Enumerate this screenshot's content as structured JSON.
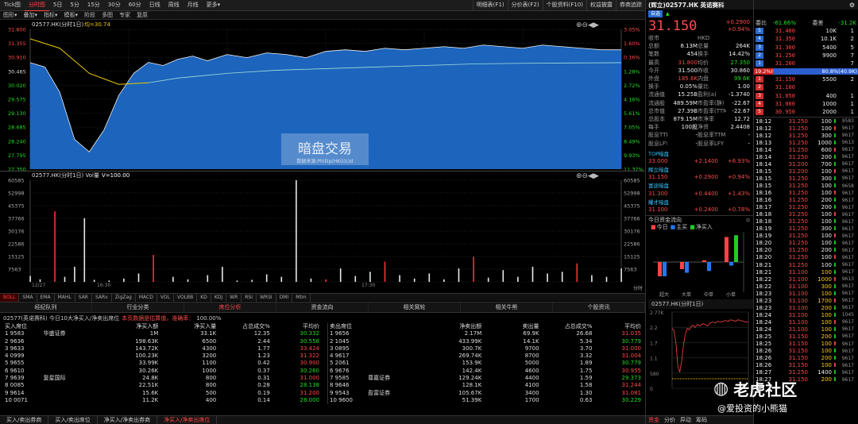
{
  "toolbar": {
    "tabs": [
      "Tick图",
      "分时图",
      "5日",
      "5分",
      "15分",
      "30分",
      "60分",
      "日线",
      "周线",
      "月线",
      "更多▾"
    ],
    "right_tabs": [
      "明细表(F1)",
      "分价表(F2)",
      "个股资料(F10)",
      "权益披露",
      "券商追踪"
    ]
  },
  "menu": [
    "图形▾",
    "叠加▾",
    "指标▾",
    "模板▾",
    "阶段",
    "多图",
    "专家",
    "复原"
  ],
  "main_chart": {
    "title": "02577.HK(分时1日)",
    "avg_label": "均=30.74",
    "watermark": "暗盘交易",
    "watermark_sub": "数据来源:Phillip(HKG)Ltd",
    "left_axis": [
      "31.800",
      "31.355",
      "30.910",
      "30.465",
      "30.020",
      "29.575",
      "29.130",
      "28.685",
      "28.240",
      "27.795",
      "27.350"
    ],
    "right_axis": [
      "3.05%",
      "1.60%",
      "0.16%",
      "1.28%",
      "2.72%",
      "4.16%",
      "5.61%",
      "7.05%",
      "8.49%",
      "9.93%",
      "11.37%"
    ],
    "line_color": "#e8c800",
    "avg_color": "#88c8c8",
    "fill_color": "#1f6fd0"
  },
  "vol_chart": {
    "title": "02577.HK(分时1日) Vol量",
    "vol_label": "V=100.00",
    "axis": [
      "60585",
      "52998",
      "45375",
      "37766",
      "30176",
      "22586",
      "15125",
      "7563"
    ],
    "dates": [
      "12/27",
      "16:30",
      "17:30"
    ],
    "tail": "分时"
  },
  "chart_data": [
    {
      "type": "line",
      "name": "price",
      "ylim": [
        27.35,
        31.8
      ],
      "x": [
        0,
        3,
        6,
        9,
        12,
        15,
        18,
        21,
        24,
        27,
        30,
        33,
        36,
        40,
        44,
        48,
        52,
        56,
        60,
        64,
        68,
        72,
        76,
        80,
        84,
        88,
        92,
        96,
        100,
        104,
        108,
        112,
        116,
        120
      ],
      "values": [
        30.74,
        30.6,
        29.8,
        28.3,
        27.9,
        28.6,
        29.7,
        30.4,
        30.75,
        30.65,
        30.85,
        30.95,
        30.8,
        31.0,
        30.9,
        31.05,
        31.0,
        30.9,
        31.1,
        31.15,
        31.1,
        31.2,
        31.15,
        31.2,
        31.25,
        31.2,
        31.3,
        31.25,
        31.2,
        31.3,
        31.25,
        31.2,
        31.15,
        31.15
      ]
    },
    {
      "type": "line",
      "name": "avg",
      "ylim": [
        27.35,
        31.8
      ],
      "x": [
        0,
        6,
        12,
        18,
        24,
        30,
        40,
        50,
        60,
        70,
        80,
        90,
        100,
        110,
        120
      ],
      "values": [
        31.5,
        31.2,
        30.4,
        30.05,
        30.1,
        30.25,
        30.4,
        30.5,
        30.55,
        30.6,
        30.65,
        30.7,
        30.72,
        30.73,
        30.74
      ]
    },
    {
      "type": "bar",
      "name": "volume",
      "ylim": [
        0,
        60585
      ],
      "x": [
        0,
        2,
        5,
        7,
        9,
        11,
        13,
        16,
        19,
        22,
        25,
        29,
        32,
        36,
        39,
        42,
        45,
        48,
        51,
        54,
        57,
        60,
        63,
        66,
        69,
        72,
        75,
        78,
        81,
        84,
        87,
        90,
        93,
        96,
        99,
        102,
        105,
        108,
        111,
        114,
        117,
        120
      ],
      "values": [
        3500,
        1500,
        42000,
        3000,
        9000,
        38000,
        1200,
        800,
        2000,
        5000,
        16000,
        3000,
        1500,
        4000,
        9000,
        800,
        1200,
        4500,
        3000,
        60585,
        2000,
        1500,
        8000,
        3500,
        6000,
        12000,
        4000,
        2000,
        5000,
        1500,
        8000,
        15000,
        2500,
        7000,
        3000,
        9000,
        5000,
        6000,
        11000,
        4000,
        3000,
        8000
      ],
      "colors": [
        "white",
        "white",
        "red",
        "white",
        "white",
        "white",
        "white",
        "white",
        "white",
        "white",
        "red",
        "white",
        "white",
        "white",
        "white",
        "white",
        "white",
        "white",
        "white",
        "white",
        "white",
        "red",
        "white",
        "white",
        "white",
        "red",
        "white",
        "white",
        "white",
        "white",
        "white",
        "red",
        "white",
        "white",
        "white",
        "white",
        "white",
        "white",
        "red",
        "white",
        "white",
        "white"
      ]
    },
    {
      "type": "bar",
      "name": "capital",
      "categories": [
        "超大",
        "大单",
        "中单",
        "小单"
      ],
      "series": [
        {
          "name": "今日",
          "color": "#ff4444",
          "values": [
            -40,
            -20,
            5,
            70
          ]
        },
        {
          "name": "主买",
          "color": "#2277ee",
          "values": [
            -40,
            -30,
            -25,
            -10
          ]
        },
        {
          "name": "净买入",
          "color": "#22cc22",
          "values": [
            0,
            0,
            0,
            75
          ]
        }
      ]
    }
  ],
  "indicators": [
    "BOLL",
    "SMA",
    "EMA",
    "MAHL",
    "SAR",
    "SARv",
    "ZigZag",
    "MACD",
    "VOL",
    "VOLBB",
    "KD",
    "KDJ",
    "WR",
    "RSI",
    "WRSI",
    "DMI",
    "Mtm"
  ],
  "panel_tabs": [
    "经纪队列",
    "行业分类",
    "席位分析",
    "资金流向",
    "相关窝轮",
    "相关牛熊",
    "个股资讯"
  ],
  "broker": {
    "summary": "02577(英诺赛科) 今日10大净买入/净卖出席位",
    "note": "本页数据是估算值，准确率：",
    "accuracy": "100.00%",
    "buy_head": [
      "买入席位",
      "净买入额",
      "净买入量",
      "占总成交%",
      "平均价"
    ],
    "sell_head": [
      "卖出席位",
      "净卖出额",
      "卖出量",
      "占总成交%",
      "平均价"
    ],
    "buy": [
      [
        "1 9583",
        "华盛证券",
        "1M",
        "33.1K",
        "12.35",
        "30.332"
      ],
      [
        "2 9636",
        "",
        "198.63K",
        "6500",
        "2.44",
        "30.558"
      ],
      [
        "3 9633",
        "",
        "143.72K",
        "4300",
        "1.77",
        "33.424"
      ],
      [
        "4 0999",
        "",
        "100.23K",
        "3200",
        "1.23",
        "31.322"
      ],
      [
        "5 9655",
        "",
        "33.99K",
        "1100",
        "0.42",
        "30.900"
      ],
      [
        "6 9610",
        "",
        "30.26K",
        "1000",
        "0.37",
        "30.260"
      ],
      [
        "7 9639",
        "复星国际",
        "24.8K",
        "800",
        "0.31",
        "31.000"
      ],
      [
        "8 0085",
        "",
        "22.51K",
        "800",
        "0.28",
        "28.138"
      ],
      [
        "9 9614",
        "",
        "15.6K",
        "500",
        "0.19",
        "31.200"
      ],
      [
        "10 0071",
        "",
        "11.2K",
        "400",
        "0.14",
        "28.000"
      ]
    ],
    "sell": [
      [
        "1 9656",
        "",
        "2.17M",
        "69.9K",
        "26.68",
        "31.035"
      ],
      [
        "2 1045",
        "",
        "433.99K",
        "14.1K",
        "5.34",
        "30.779"
      ],
      [
        "3 0895",
        "",
        "300.7K",
        "9700",
        "3.70",
        "31.000"
      ],
      [
        "4 9617",
        "",
        "269.74K",
        "8700",
        "3.32",
        "31.004"
      ],
      [
        "5 2061",
        "",
        "153.9K",
        "5000",
        "1.89",
        "30.779"
      ],
      [
        "6 9676",
        "",
        "142.4K",
        "4600",
        "1.75",
        "30.955"
      ],
      [
        "7 9585",
        "尊嘉证券",
        "129.24K",
        "4400",
        "1.59",
        "29.373"
      ],
      [
        "8 9646",
        "",
        "128.1K",
        "4100",
        "1.58",
        "31.244"
      ],
      [
        "9 9543",
        "盈富证券",
        "105.67K",
        "3400",
        "1.30",
        "31.081"
      ],
      [
        "10 9600",
        "",
        "51.39K",
        "1700",
        "0.63",
        "30.229"
      ]
    ]
  },
  "bottom_tabs": [
    "买入/卖出券商",
    "买入/卖出席位",
    "净买入/净卖出券商",
    "净买入/净卖出席位"
  ],
  "quote": {
    "title": "(辉立)02577.HK 英诺赛科",
    "price": "31.150",
    "change": "+0.2900",
    "pct": "+0.94%",
    "tag": "自选",
    "stats": [
      [
        "收市",
        "",
        "HKD",
        ""
      ],
      [
        "总额",
        "8.13M",
        "总量",
        "264K"
      ],
      [
        "笔数",
        "454",
        "换手",
        "14.42%"
      ],
      [
        "最高",
        "31.800",
        "均价",
        "27.350"
      ],
      [
        "今开",
        "31.500",
        "昨收",
        "30.860"
      ],
      [
        "外盘",
        "185.6K",
        "内盘",
        "99.6K"
      ],
      [
        "换手",
        "0.05%",
        "量比",
        "1.00"
      ],
      [
        "流通值",
        "15.25B",
        "盈利(a)",
        "-1.3740"
      ],
      [
        "流通股",
        "489.59M",
        "市盈率(静)",
        "-22.67"
      ],
      [
        "总市值",
        "27.39B",
        "市盈率(TTM)",
        "-22.67"
      ],
      [
        "总股本",
        "879.15M",
        "市净率",
        "12.72"
      ],
      [
        "每手",
        "100股",
        "净资",
        "2.4408"
      ],
      [
        "股息TTM",
        "-",
        "股息率TTM",
        "-"
      ],
      [
        "股息LFY",
        "-",
        "股息率LFY",
        "-"
      ]
    ],
    "related": [
      {
        "name": "TOP暗盘",
        "price": "33.000",
        "chg": "+2.1400",
        "pct": "+6.93%"
      },
      {
        "name": "辉立暗盘",
        "price": "31.150",
        "chg": "+0.2900",
        "pct": "+0.94%"
      },
      {
        "name": "富途暗盘",
        "price": "31.300",
        "chg": "+0.4400",
        "pct": "+1.43%"
      },
      {
        "name": "耀才暗盘",
        "price": "31.100",
        "chg": "+0.2400",
        "pct": "+0.78%"
      }
    ],
    "cap_title": "今日资金流向",
    "cap_legend": [
      "今日",
      "主买",
      "净买入"
    ],
    "mini_title": "02577.HK(分时1日)",
    "mini_axis": [
      "2.77K",
      "2.2",
      "1.7",
      "1.1",
      "580",
      "0"
    ],
    "bottom_tabs": [
      "资金",
      "分价",
      "异动",
      "筹码"
    ],
    "bottom_note": "双击或按F1查看更多明细"
  },
  "book": {
    "ratio_label": "委比",
    "ratio": "-61.66%",
    "diff_label": "委差",
    "diff": "-31.2K",
    "asks": [
      [
        "5",
        "31.400",
        "10K",
        "1"
      ],
      [
        "4",
        "31.350",
        "10.1K",
        "2"
      ],
      [
        "3",
        "31.300",
        "5400",
        "5"
      ],
      [
        "2",
        "31.250",
        "9900",
        "7"
      ],
      [
        "1",
        "31.200",
        "",
        "7"
      ]
    ],
    "bar_left": "19.2%(9700)",
    "bar_right": "80.8%(40.9K)",
    "bids": [
      [
        "1",
        "31.150",
        "5500",
        "2"
      ],
      [
        "2",
        "31.100",
        "",
        ""
      ],
      [
        "3",
        "31.050",
        "400",
        "1"
      ],
      [
        "4",
        "31.000",
        "1000",
        "1"
      ],
      [
        "5",
        "30.950",
        "2000",
        "1"
      ]
    ],
    "ticks": [
      [
        "18:12",
        "31.250",
        "100",
        "9583"
      ],
      [
        "18:12",
        "31.250",
        "100",
        "9617"
      ],
      [
        "18:12",
        "31.250",
        "300",
        "9617"
      ],
      [
        "18:13",
        "31.250",
        "1000",
        "9613"
      ],
      [
        "18:14",
        "31.250",
        "600",
        "9617"
      ],
      [
        "18:14",
        "31.250",
        "200",
        "9617"
      ],
      [
        "18:14",
        "31.200",
        "700",
        "9617"
      ],
      [
        "18:15",
        "31.200",
        "100",
        "9617"
      ],
      [
        "18:15",
        "31.250",
        "300",
        "9617"
      ],
      [
        "18:15",
        "31.250",
        "100",
        "9658"
      ],
      [
        "18:16",
        "31.250",
        "100",
        "9617"
      ],
      [
        "18:16",
        "31.250",
        "200",
        "9617"
      ],
      [
        "18:17",
        "31.250",
        "200",
        "9617"
      ],
      [
        "18:18",
        "31.250",
        "100",
        "9617"
      ],
      [
        "18:18",
        "31.250",
        "100",
        "9617"
      ],
      [
        "18:19",
        "31.250",
        "300",
        "9617"
      ],
      [
        "18:19",
        "31.250",
        "100",
        "9617"
      ],
      [
        "18:20",
        "31.250",
        "100",
        "9617"
      ],
      [
        "18:20",
        "31.250",
        "200",
        "9617"
      ],
      [
        "18:20",
        "31.250",
        "100",
        "9617"
      ],
      [
        "18:21",
        "31.250",
        "100",
        "9617"
      ],
      [
        "18:21",
        "31.100",
        "100",
        "9617"
      ],
      [
        "18:22",
        "31.100",
        "1000",
        "9613"
      ],
      [
        "18:22",
        "31.100",
        "300",
        "9617"
      ],
      [
        "18:23",
        "31.100",
        "100",
        "9617"
      ],
      [
        "18:23",
        "31.100",
        "1700",
        "9617"
      ],
      [
        "18:23",
        "31.100",
        "200",
        "9617"
      ],
      [
        "18:24",
        "31.100",
        "100",
        "1045"
      ],
      [
        "18:24",
        "31.100",
        "100",
        "9617"
      ],
      [
        "18:24",
        "31.100",
        "100",
        "9617"
      ],
      [
        "18:25",
        "31.150",
        "200",
        "9617"
      ],
      [
        "18:25",
        "31.150",
        "100",
        "9617"
      ],
      [
        "18:26",
        "31.150",
        "100",
        "9617"
      ],
      [
        "18:26",
        "31.150",
        "200",
        "9617"
      ],
      [
        "18:26",
        "31.150",
        "100",
        "9617"
      ],
      [
        "18:27",
        "31.250",
        "1400",
        "9617"
      ],
      [
        "18:27",
        "31.150",
        "200",
        "9617"
      ]
    ]
  },
  "brand": {
    "name": "老虎社区",
    "user": "@爱投资的小熊猫"
  }
}
